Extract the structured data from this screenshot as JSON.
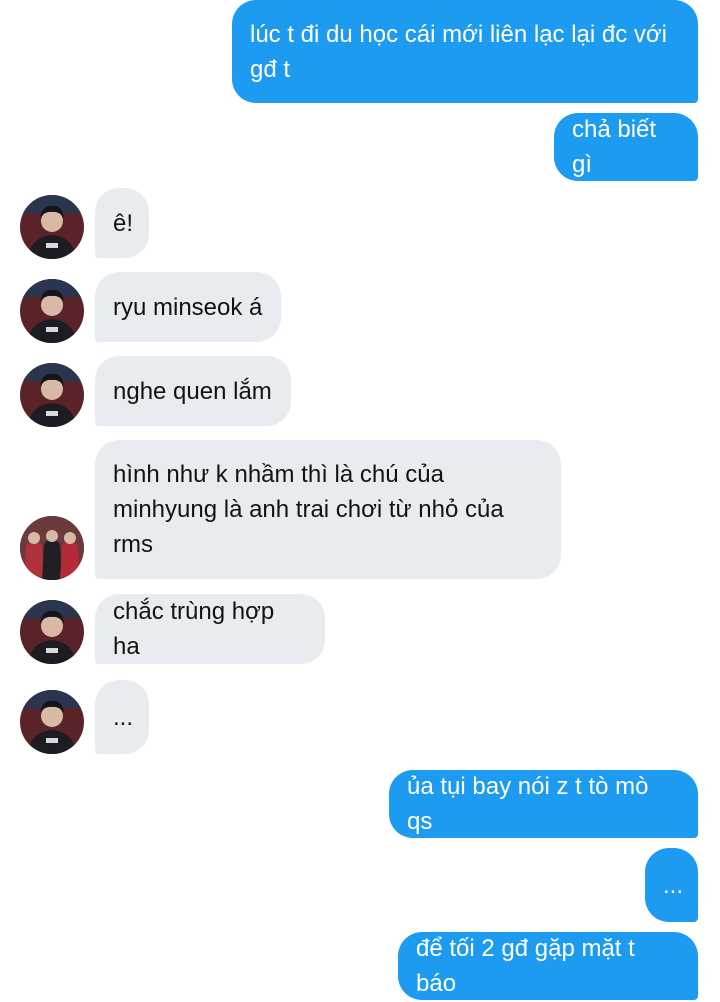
{
  "thread": {
    "messages": [
      {
        "id": "m1",
        "direction": "outgoing",
        "text": "lúc t đi du học cái mới liên lạc lại đc với gđ t"
      },
      {
        "id": "m2",
        "direction": "outgoing",
        "text": "chả biết gì"
      },
      {
        "id": "m3",
        "direction": "incoming",
        "text": "ê!",
        "avatar": "profile-photo"
      },
      {
        "id": "m4",
        "direction": "incoming",
        "text": "ryu minseok á",
        "avatar": "profile-photo"
      },
      {
        "id": "m5",
        "direction": "incoming",
        "text": "nghe quen lắm",
        "avatar": "profile-photo"
      },
      {
        "id": "m6",
        "direction": "incoming",
        "text": "hình như k nhầm thì là chú của minhyung là anh trai chơi từ nhỏ của rms",
        "avatar": "group-photo"
      },
      {
        "id": "m7",
        "direction": "incoming",
        "text": "chắc trùng hợp ha",
        "avatar": "profile-photo"
      },
      {
        "id": "m8",
        "direction": "incoming",
        "text": "...",
        "avatar": "profile-photo"
      },
      {
        "id": "m9",
        "direction": "outgoing",
        "text": "ủa tụi bay nói z t tò mò qs"
      },
      {
        "id": "m10",
        "direction": "outgoing",
        "text": "..."
      },
      {
        "id": "m11",
        "direction": "outgoing",
        "text": "để tối 2 gđ gặp mặt t báo"
      }
    ]
  },
  "colors": {
    "outgoing_bubble": "#1d9bf0",
    "incoming_bubble": "#e8ecf0",
    "outgoing_text": "#ffffff",
    "incoming_text": "#0f1419"
  }
}
